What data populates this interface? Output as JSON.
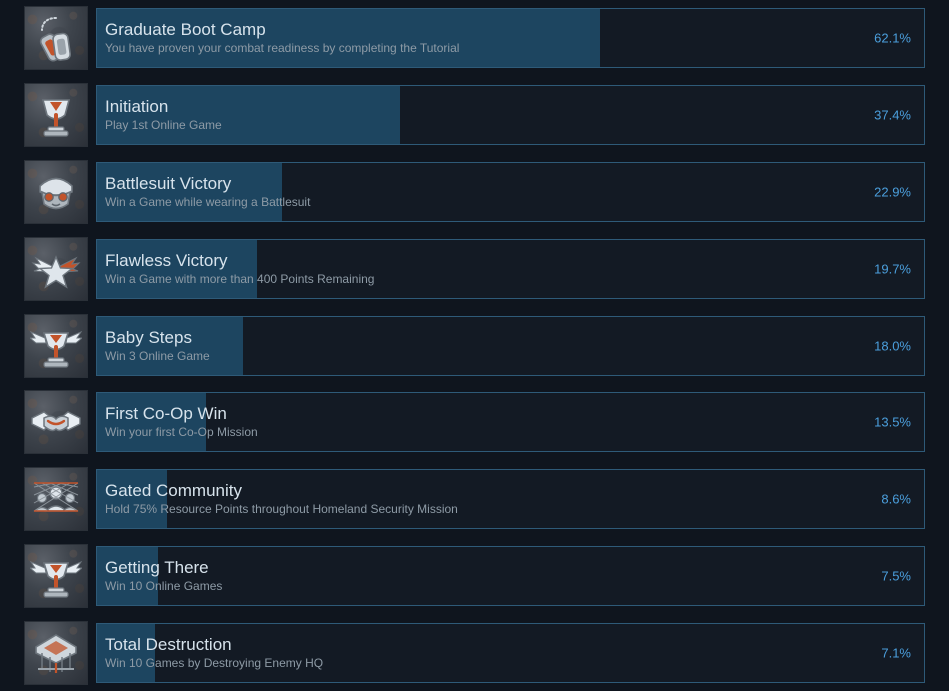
{
  "view": {
    "name": "steam-global-achievement-stats",
    "colors": {
      "page_background": "#0f151e",
      "bar_track": "#131a24",
      "bar_fill": "#1d4560",
      "bar_border": "#2e5a78",
      "title_text": "#d7e3ec",
      "description_text": "#8e9ba6",
      "percent_text": "#4b9fdd"
    }
  },
  "chart_data": {
    "type": "bar",
    "title": "",
    "xlabel": "",
    "ylabel": "",
    "xlim": [
      0,
      100
    ],
    "orientation": "horizontal",
    "categories": [
      "Graduate Boot Camp",
      "Initiation",
      "Battlesuit Victory",
      "Flawless Victory",
      "Baby Steps",
      "First Co-Op Win",
      "Gated Community",
      "Getting There",
      "Total Destruction"
    ],
    "values": [
      62.1,
      37.4,
      22.9,
      19.7,
      18.0,
      13.5,
      8.6,
      7.5,
      7.1
    ],
    "value_labels": [
      "62.1%",
      "37.4%",
      "22.9%",
      "19.7%",
      "18.0%",
      "13.5%",
      "8.6%",
      "7.5%",
      "7.1%"
    ]
  },
  "achievements": [
    {
      "title": "Graduate Boot Camp",
      "description": "You have proven your combat readiness by completing the Tutorial",
      "percent_label": "62.1%",
      "percent": 62.1,
      "icon": "dog-tags-icon"
    },
    {
      "title": "Initiation",
      "description": "Play 1st Online Game",
      "percent_label": "37.4%",
      "percent": 37.4,
      "icon": "trophy-cup-icon"
    },
    {
      "title": "Battlesuit Victory",
      "description": "Win a Game while wearing a Battlesuit",
      "percent_label": "22.9%",
      "percent": 22.9,
      "icon": "battlesuit-helmet-icon"
    },
    {
      "title": "Flawless Victory",
      "description": "Win a Game with more than 400 Points Remaining",
      "percent_label": "19.7%",
      "percent": 19.7,
      "icon": "winged-star-icon"
    },
    {
      "title": "Baby Steps",
      "description": "Win 3 Online Game",
      "percent_label": "18.0%",
      "percent": 18.0,
      "icon": "winged-trophy-icon"
    },
    {
      "title": "First Co-Op Win",
      "description": "Win your first Co-Op Mission",
      "percent_label": "13.5%",
      "percent": 13.5,
      "icon": "handshake-icon"
    },
    {
      "title": "Gated Community",
      "description": "Hold 75% Resource Points throughout Homeland Security Mission",
      "percent_label": "8.6%",
      "percent": 8.6,
      "icon": "people-behind-fence-icon"
    },
    {
      "title": "Getting There",
      "description": "Win 10 Online Games",
      "percent_label": "7.5%",
      "percent": 7.5,
      "icon": "winged-trophy-icon"
    },
    {
      "title": "Total Destruction",
      "description": "Win 10 Games by Destroying Enemy HQ",
      "percent_label": "7.1%",
      "percent": 7.1,
      "icon": "destroyed-base-icon"
    }
  ]
}
